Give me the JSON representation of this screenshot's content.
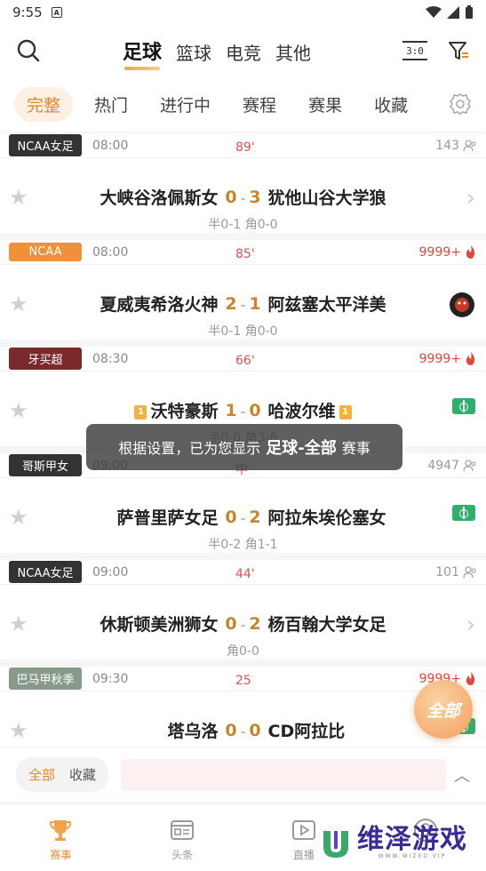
{
  "status_bar": {
    "time": "9:55",
    "notif_glyph": "A"
  },
  "topnav": {
    "sports": [
      "足球",
      "篮球",
      "电竞",
      "其他"
    ],
    "active_sport": 0,
    "score_icon_text": "3:0"
  },
  "subnav": {
    "tabs": [
      "完整",
      "热门",
      "进行中",
      "赛程",
      "赛果",
      "收藏"
    ],
    "active_tab": 0
  },
  "matches": [
    {
      "league": "NCAA女足",
      "league_color": "#333333",
      "kickoff": "08:00",
      "minute": "89'",
      "count": "143",
      "count_type": "users",
      "home": "大峡谷洛佩斯女",
      "home_score": "0",
      "away_score": "3",
      "away": "犹他山谷大学狼",
      "sub": "半0-1 角0-0",
      "side": "chevron",
      "home_rank": "",
      "away_rank": ""
    },
    {
      "league": "NCAA",
      "league_color": "#f0913a",
      "kickoff": "08:00",
      "minute": "85'",
      "count": "9999+",
      "count_type": "hot",
      "home": "夏威夷希洛火神",
      "home_score": "2",
      "away_score": "1",
      "away": "阿兹塞太平洋美",
      "sub": "半0-1 角0-0",
      "side": "avatar",
      "home_rank": "",
      "away_rank": ""
    },
    {
      "league": "牙买超",
      "league_color": "#7a2a2a",
      "kickoff": "08:30",
      "minute": "66'",
      "count": "9999+",
      "count_type": "hot",
      "home": "沃特豪斯",
      "home_score": "1",
      "away_score": "0",
      "away": "哈波尔维",
      "sub": "半0-0 角3-6",
      "side": "pitch",
      "home_rank": "1",
      "away_rank": "1"
    },
    {
      "league": "哥斯甲女",
      "league_color": "#333333",
      "kickoff": "09:00",
      "minute": "中",
      "count": "4947",
      "count_type": "users",
      "home": "萨普里萨女足",
      "home_score": "0",
      "away_score": "2",
      "away": "阿拉朱埃伦塞女",
      "sub": "半0-2 角1-1",
      "side": "pitch",
      "home_rank": "",
      "away_rank": ""
    },
    {
      "league": "NCAA女足",
      "league_color": "#333333",
      "kickoff": "09:00",
      "minute": "44'",
      "count": "101",
      "count_type": "users",
      "home": "休斯顿美洲狮女",
      "home_score": "0",
      "away_score": "2",
      "away": "杨百翰大学女足",
      "sub": "角0-0",
      "side": "chevron",
      "home_rank": "",
      "away_rank": ""
    },
    {
      "league": "巴马甲秋季",
      "league_color": "#8a9a8a",
      "kickoff": "09:30",
      "minute": "25",
      "count": "9999+",
      "count_type": "hot",
      "home": "塔乌洛",
      "home_score": "0",
      "away_score": "0",
      "away": "CD阿拉比",
      "sub": "",
      "side": "pitch",
      "home_rank": "",
      "away_rank": ""
    }
  ],
  "toast": {
    "prefix": "根据设置，已为您显示",
    "highlight": "足球-全部",
    "suffix": "赛事"
  },
  "fab": {
    "label": "全部"
  },
  "filterbar": {
    "options": [
      "全部",
      "收藏"
    ],
    "active": 0
  },
  "tabbar": {
    "tabs": [
      "赛事",
      "头条",
      "直播",
      ""
    ],
    "active": 0
  },
  "watermark": {
    "brand": "维泽游戏",
    "sub": "WWW.WIZED.VIP"
  },
  "colors": {
    "accent": "#e08a30",
    "score": "#c8852e",
    "minute": "#e05050",
    "hot": "#e0483c",
    "pitch": "#2db06a"
  }
}
